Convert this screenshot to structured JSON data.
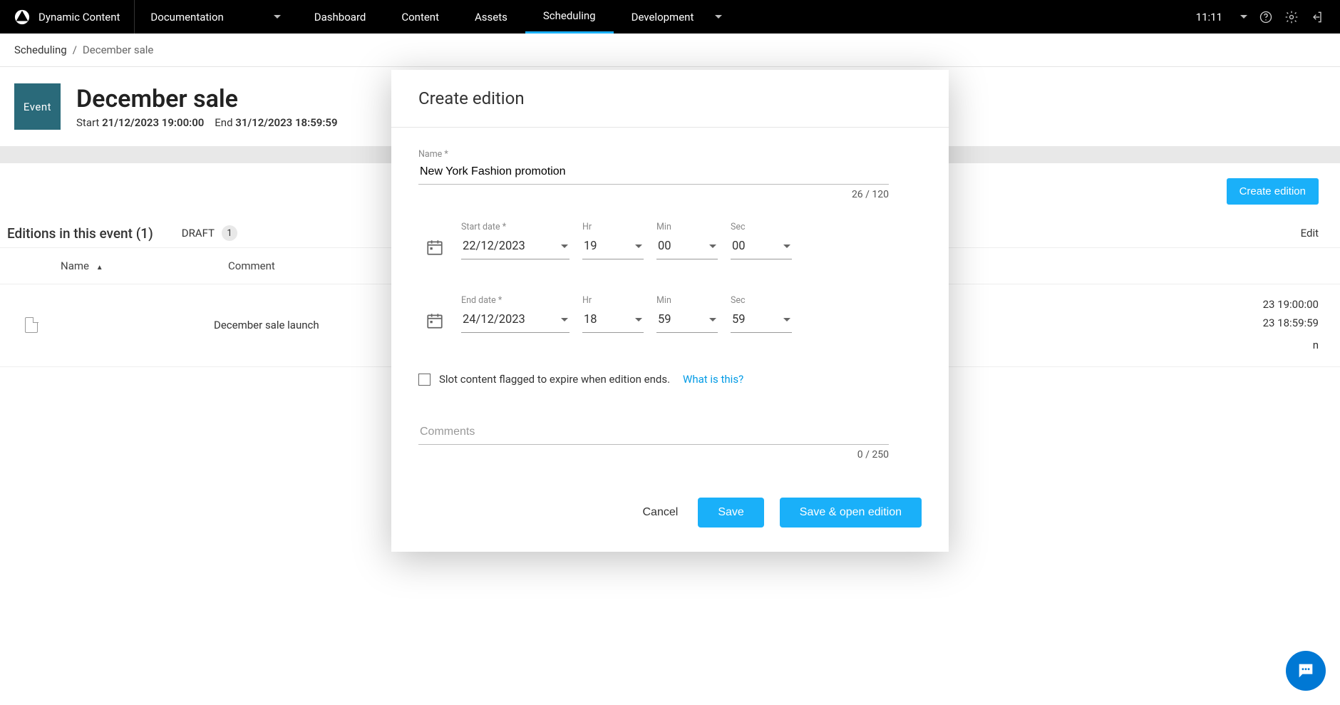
{
  "brand": "Dynamic Content",
  "hub_name": "Documentation",
  "nav": {
    "dashboard": "Dashboard",
    "content": "Content",
    "assets": "Assets",
    "scheduling": "Scheduling",
    "development": "Development"
  },
  "clock": "11:11",
  "breadcrumb": {
    "root": "Scheduling",
    "sep": "/",
    "current": "December sale"
  },
  "event": {
    "thumb_label": "Event",
    "title": "December sale",
    "start_label": "Start",
    "start_value": "21/12/2023 19:00:00",
    "end_label": "End",
    "end_value": "31/12/2023 18:59:59"
  },
  "action": {
    "create_edition": "Create edition"
  },
  "editions": {
    "title_pre": "Editions in this event",
    "count_paren": "(1)",
    "filter_label": "DRAFT",
    "filter_badge": "1",
    "edit_link": "Edit",
    "cols": {
      "name": "Name",
      "comment": "Comment"
    },
    "sort_glyph": "▲",
    "rows": [
      {
        "name": "December sale launch",
        "comment": "",
        "start": "23 19:00:00",
        "end": "23 18:59:59"
      }
    ]
  },
  "modal": {
    "title": "Create edition",
    "name_label": "Name *",
    "name_value": "New York Fashion promotion",
    "name_counter": "26 / 120",
    "start_date_label": "Start date *",
    "start_date_value": "22/12/2023",
    "end_date_label": "End date *",
    "end_date_value": "24/12/2023",
    "hr_label": "Hr",
    "min_label": "Min",
    "sec_label": "Sec",
    "start_hr": "19",
    "start_min": "00",
    "start_sec": "00",
    "end_hr": "18",
    "end_min": "59",
    "end_sec": "59",
    "expire_text": "Slot content flagged to expire when edition ends.",
    "expire_link": "What is this?",
    "comments_placeholder": "Comments",
    "comments_counter": "0 / 250",
    "cancel": "Cancel",
    "save": "Save",
    "save_open": "Save & open edition"
  }
}
